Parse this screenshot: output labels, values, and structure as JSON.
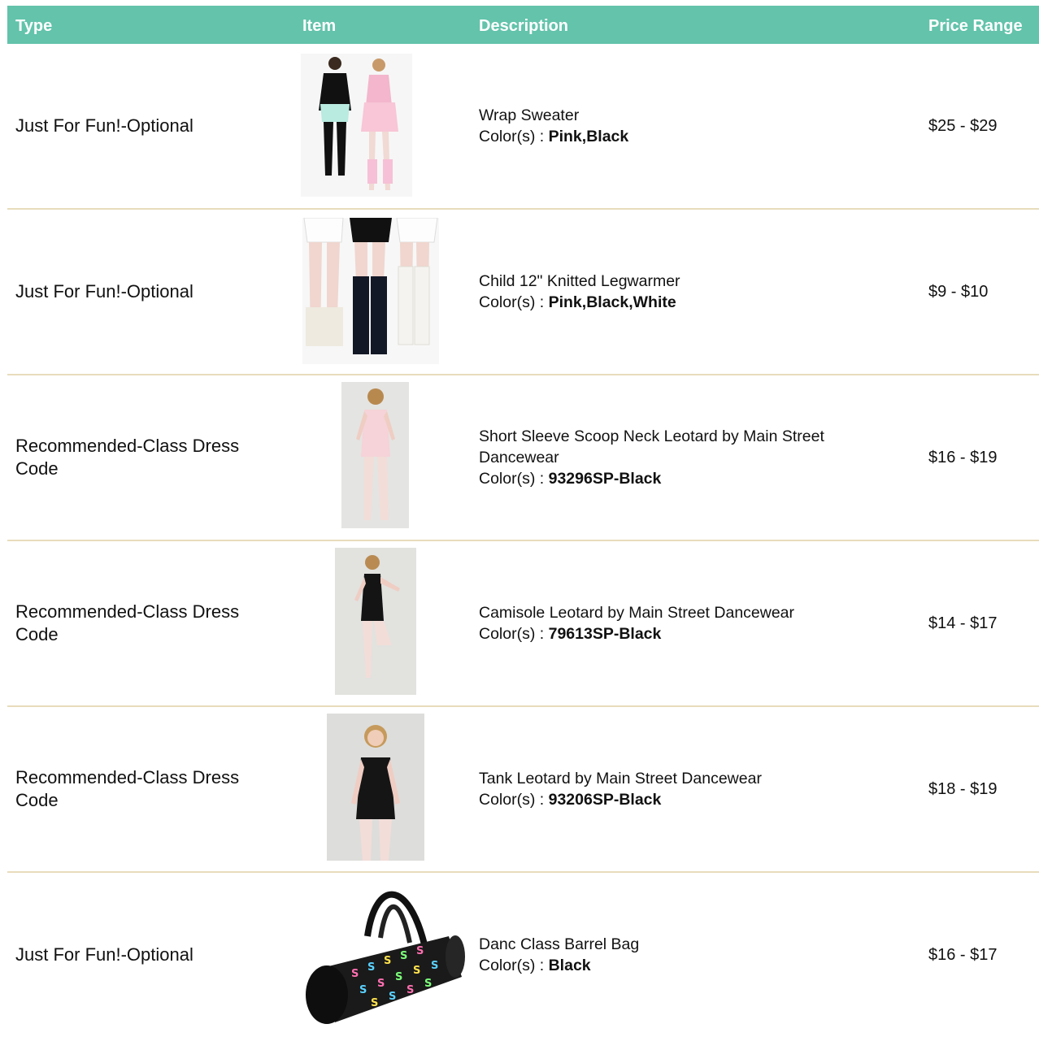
{
  "header": {
    "type": "Type",
    "item": "Item",
    "description": "Description",
    "price": "Price Range"
  },
  "colors_prefix": "Color(s) : ",
  "rows": [
    {
      "type": "Just For Fun!-Optional",
      "name": "Wrap Sweater",
      "colors": "Pink,Black",
      "price": "$25 - $29",
      "image": "dancers-wrap-sweater-photo"
    },
    {
      "type": "Just For Fun!-Optional",
      "name": "Child 12\" Knitted Legwarmer",
      "colors": "Pink,Black,White",
      "price": "$9 - $10",
      "image": "legwarmers-photo"
    },
    {
      "type": "Recommended-Class Dress Code",
      "name": "Short Sleeve Scoop Neck Leotard by Main Street Dancewear",
      "colors": "93296SP-Black",
      "price": "$16 - $19",
      "image": "short-sleeve-leotard-photo"
    },
    {
      "type": "Recommended-Class Dress Code",
      "name": "Camisole Leotard by Main Street Dancewear",
      "colors": "79613SP-Black",
      "price": "$14 - $17",
      "image": "camisole-leotard-photo"
    },
    {
      "type": "Recommended-Class Dress Code",
      "name": "Tank Leotard by Main Street Dancewear",
      "colors": "93206SP-Black",
      "price": "$18 - $19",
      "image": "tank-leotard-photo"
    },
    {
      "type": "Just For Fun!-Optional",
      "name": "Danc Class Barrel Bag",
      "colors": "Black",
      "price": "$16 - $17",
      "image": "barrel-bag-photo"
    }
  ],
  "palette": {
    "header_bg": "#63c3ab",
    "divider": "#e8dcbc"
  }
}
